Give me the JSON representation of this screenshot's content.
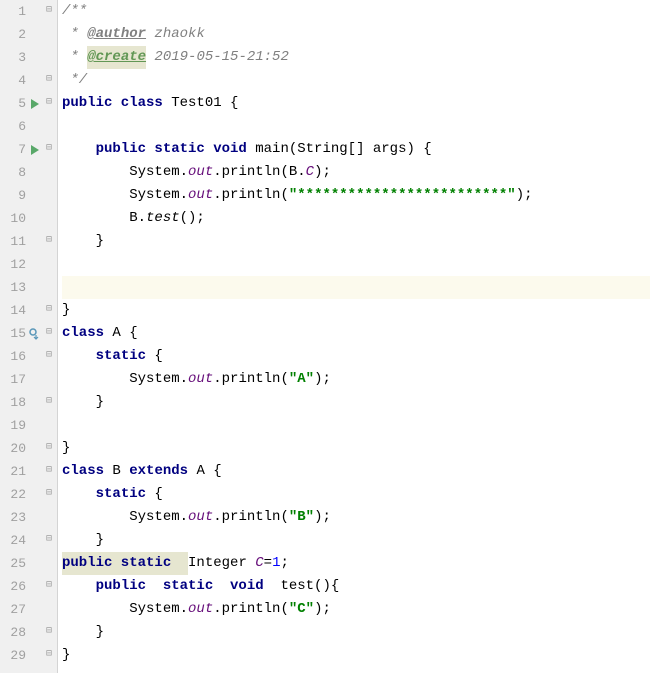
{
  "lines": [
    {
      "n": 1,
      "icon": "",
      "fold": "⊟",
      "tokens": [
        {
          "t": "/**",
          "c": "c-doc"
        }
      ]
    },
    {
      "n": 2,
      "icon": "",
      "fold": "",
      "tokens": [
        {
          "t": " * ",
          "c": "c-doc"
        },
        {
          "t": "@author",
          "c": "c-tag"
        },
        {
          "t": " zhaokk",
          "c": "c-tagval"
        }
      ]
    },
    {
      "n": 3,
      "icon": "",
      "fold": "",
      "tokens": [
        {
          "t": " * ",
          "c": "c-doc"
        },
        {
          "t": "@create",
          "c": "c-tag-green",
          "hl": true
        },
        {
          "t": " 2019-05-15-21:52",
          "c": "c-tagval"
        }
      ]
    },
    {
      "n": 4,
      "icon": "",
      "fold": "⊟",
      "tokens": [
        {
          "t": " */",
          "c": "c-doc"
        }
      ]
    },
    {
      "n": 5,
      "icon": "run",
      "fold": "⊟",
      "tokens": [
        {
          "t": "public class ",
          "c": "kw"
        },
        {
          "t": "Test01 {",
          "c": "ident"
        }
      ]
    },
    {
      "n": 6,
      "icon": "",
      "fold": "",
      "tokens": []
    },
    {
      "n": 7,
      "icon": "run",
      "fold": "⊟",
      "tokens": [
        {
          "t": "    ",
          "c": ""
        },
        {
          "t": "public static void ",
          "c": "kw"
        },
        {
          "t": "main(String[] args) {",
          "c": "ident"
        }
      ]
    },
    {
      "n": 8,
      "icon": "",
      "fold": "",
      "tokens": [
        {
          "t": "        System.",
          "c": "ident"
        },
        {
          "t": "out",
          "c": "field"
        },
        {
          "t": ".println(B.",
          "c": "ident"
        },
        {
          "t": "C",
          "c": "field"
        },
        {
          "t": ");",
          "c": "punct"
        }
      ]
    },
    {
      "n": 9,
      "icon": "",
      "fold": "",
      "tokens": [
        {
          "t": "        System.",
          "c": "ident"
        },
        {
          "t": "out",
          "c": "field"
        },
        {
          "t": ".println(",
          "c": "ident"
        },
        {
          "t": "\"*************************\"",
          "c": "str"
        },
        {
          "t": ");",
          "c": "punct"
        }
      ]
    },
    {
      "n": 10,
      "icon": "",
      "fold": "",
      "tokens": [
        {
          "t": "        B.",
          "c": "ident"
        },
        {
          "t": "test",
          "c": "ident",
          "style": "font-style:italic"
        },
        {
          "t": "();",
          "c": "punct"
        }
      ]
    },
    {
      "n": 11,
      "icon": "",
      "fold": "⊟",
      "tokens": [
        {
          "t": "    }",
          "c": "ident"
        }
      ]
    },
    {
      "n": 12,
      "icon": "",
      "fold": "",
      "tokens": []
    },
    {
      "n": 13,
      "icon": "",
      "fold": "",
      "tokens": [],
      "current": true
    },
    {
      "n": 14,
      "icon": "",
      "fold": "⊟",
      "tokens": [
        {
          "t": "}",
          "c": "ident"
        }
      ]
    },
    {
      "n": 15,
      "icon": "impl",
      "fold": "⊟",
      "tokens": [
        {
          "t": "class ",
          "c": "kw"
        },
        {
          "t": "A {",
          "c": "ident"
        }
      ]
    },
    {
      "n": 16,
      "icon": "",
      "fold": "⊟",
      "tokens": [
        {
          "t": "    ",
          "c": ""
        },
        {
          "t": "static ",
          "c": "kw"
        },
        {
          "t": "{",
          "c": "ident"
        }
      ]
    },
    {
      "n": 17,
      "icon": "",
      "fold": "",
      "tokens": [
        {
          "t": "        System.",
          "c": "ident"
        },
        {
          "t": "out",
          "c": "field"
        },
        {
          "t": ".println(",
          "c": "ident"
        },
        {
          "t": "\"A\"",
          "c": "str"
        },
        {
          "t": ");",
          "c": "punct"
        }
      ]
    },
    {
      "n": 18,
      "icon": "",
      "fold": "⊟",
      "tokens": [
        {
          "t": "    }",
          "c": "ident"
        }
      ]
    },
    {
      "n": 19,
      "icon": "",
      "fold": "",
      "tokens": []
    },
    {
      "n": 20,
      "icon": "",
      "fold": "⊟",
      "tokens": [
        {
          "t": "}",
          "c": "ident"
        }
      ]
    },
    {
      "n": 21,
      "icon": "",
      "fold": "⊟",
      "tokens": [
        {
          "t": "class ",
          "c": "kw"
        },
        {
          "t": "B ",
          "c": "ident"
        },
        {
          "t": "extends ",
          "c": "kw"
        },
        {
          "t": "A {",
          "c": "ident"
        }
      ]
    },
    {
      "n": 22,
      "icon": "",
      "fold": "⊟",
      "tokens": [
        {
          "t": "    ",
          "c": ""
        },
        {
          "t": "static ",
          "c": "kw"
        },
        {
          "t": "{",
          "c": "ident"
        }
      ]
    },
    {
      "n": 23,
      "icon": "",
      "fold": "",
      "tokens": [
        {
          "t": "        System.",
          "c": "ident"
        },
        {
          "t": "out",
          "c": "field"
        },
        {
          "t": ".println(",
          "c": "ident"
        },
        {
          "t": "\"B\"",
          "c": "str"
        },
        {
          "t": ");",
          "c": "punct"
        }
      ]
    },
    {
      "n": 24,
      "icon": "",
      "fold": "⊟",
      "tokens": [
        {
          "t": "    }",
          "c": "ident"
        }
      ]
    },
    {
      "n": 25,
      "icon": "",
      "fold": "",
      "tokens": [
        {
          "t": "public static  ",
          "c": "kw",
          "hl": true
        },
        {
          "t": "Integer ",
          "c": "ident"
        },
        {
          "t": "C",
          "c": "field"
        },
        {
          "t": "=",
          "c": "punct"
        },
        {
          "t": "1",
          "c": "ident",
          "style": "color:#0000ff"
        },
        {
          "t": ";",
          "c": "punct"
        }
      ]
    },
    {
      "n": 26,
      "icon": "",
      "fold": "⊟",
      "tokens": [
        {
          "t": "    ",
          "c": ""
        },
        {
          "t": "public  static  void  ",
          "c": "kw"
        },
        {
          "t": "test(){",
          "c": "ident"
        }
      ]
    },
    {
      "n": 27,
      "icon": "",
      "fold": "",
      "tokens": [
        {
          "t": "        System.",
          "c": "ident"
        },
        {
          "t": "out",
          "c": "field"
        },
        {
          "t": ".println(",
          "c": "ident"
        },
        {
          "t": "\"C\"",
          "c": "str"
        },
        {
          "t": ");",
          "c": "punct"
        }
      ]
    },
    {
      "n": 28,
      "icon": "",
      "fold": "⊟",
      "tokens": [
        {
          "t": "    }",
          "c": "ident"
        }
      ]
    },
    {
      "n": 29,
      "icon": "",
      "fold": "⊟",
      "tokens": [
        {
          "t": "}",
          "c": "ident"
        }
      ]
    }
  ]
}
